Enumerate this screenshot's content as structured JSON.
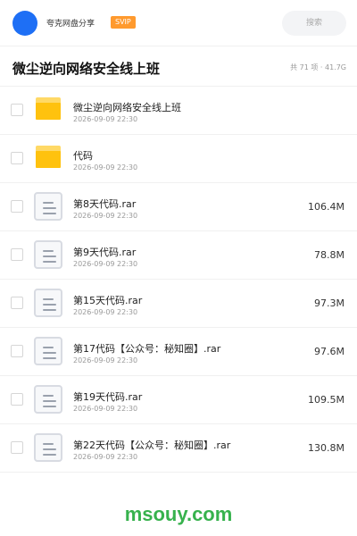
{
  "header": {
    "user_name": "夸克网盘分享",
    "badge": "SVIP",
    "search_placeholder": "搜索"
  },
  "folder": {
    "title": "微尘逆向网络安全线上班",
    "stats": "共 71 项 · 41.7G"
  },
  "items": [
    {
      "type": "folder",
      "name": "微尘逆向网络安全线上班",
      "date": "2026-09-09 22:30",
      "size": ""
    },
    {
      "type": "folder",
      "name": "代码",
      "date": "2026-09-09 22:30",
      "size": ""
    },
    {
      "type": "file",
      "name": "第8天代码.rar",
      "date": "2026-09-09 22:30",
      "size": "106.4M"
    },
    {
      "type": "file",
      "name": "第9天代码.rar",
      "date": "2026-09-09 22:30",
      "size": "78.8M"
    },
    {
      "type": "file",
      "name": "第15天代码.rar",
      "date": "2026-09-09 22:30",
      "size": "97.3M"
    },
    {
      "type": "file",
      "name": "第17代码【公众号：秘知圈】.rar",
      "date": "2026-09-09 22:30",
      "size": "97.6M"
    },
    {
      "type": "file",
      "name": "第19天代码.rar",
      "date": "2026-09-09 22:30",
      "size": "109.5M"
    },
    {
      "type": "file",
      "name": "第22天代码【公众号：秘知圈】.rar",
      "date": "2026-09-09 22:30",
      "size": "130.8M"
    }
  ],
  "watermark": "msouy.com",
  "colors": {
    "avatar": "#1e6ff5",
    "badge": "#ff9a2e",
    "folder": "#ffc20e",
    "watermark": "#37b24d"
  }
}
